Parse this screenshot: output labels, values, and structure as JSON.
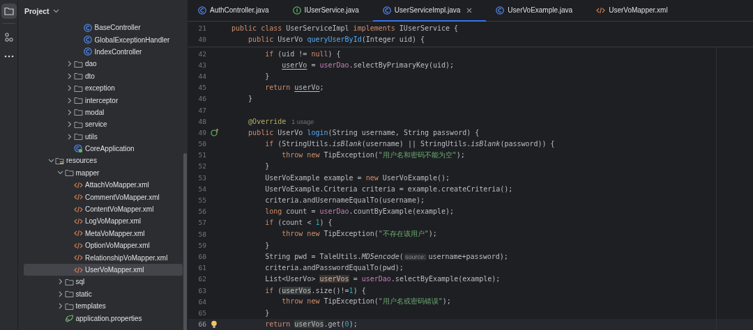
{
  "tool_strip": [
    {
      "kind": "project",
      "selected": true
    },
    {
      "kind": "structure",
      "selected": false
    },
    {
      "kind": "more",
      "selected": false
    }
  ],
  "project_panel": {
    "title": "Project",
    "tree": [
      {
        "children": [
          {
            "children": [
              {
                "children": [
                  {
                    "label": "BaseController",
                    "kind": "class",
                    "selected": false
                  },
                  {
                    "label": "GlobalExceptionHandler",
                    "kind": "class",
                    "selected": false
                  },
                  {
                    "label": "IndexController",
                    "kind": "class",
                    "selected": false
                  }
                ]
              },
              {
                "label": "dao",
                "kind": "folder",
                "expanded": false,
                "selected": false
              },
              {
                "label": "dto",
                "kind": "folder",
                "expanded": false,
                "selected": false
              },
              {
                "label": "exception",
                "kind": "folder",
                "expanded": false,
                "selected": false
              },
              {
                "label": "interceptor",
                "kind": "folder",
                "expanded": false,
                "selected": false
              },
              {
                "label": "modal",
                "kind": "folder",
                "expanded": false,
                "selected": false
              },
              {
                "label": "service",
                "kind": "folder",
                "expanded": false,
                "selected": false
              },
              {
                "label": "utils",
                "kind": "folder",
                "expanded": false,
                "selected": false
              },
              {
                "label": "CoreApplication",
                "kind": "app",
                "selected": false
              }
            ]
          }
        ]
      },
      {
        "label": "resources",
        "kind": "resources",
        "expanded": true,
        "selected": false,
        "children": [
          {
            "label": "mapper",
            "kind": "folder",
            "expanded": true,
            "selected": false,
            "children": [
              {
                "label": "AttachVoMapper.xml",
                "kind": "xml",
                "selected": false
              },
              {
                "label": "CommentVoMapper.xml",
                "kind": "xml",
                "selected": false
              },
              {
                "label": "ContentVoMapper.xml",
                "kind": "xml",
                "selected": false
              },
              {
                "label": "LogVoMapper.xml",
                "kind": "xml",
                "selected": false
              },
              {
                "label": "MetaVoMapper.xml",
                "kind": "xml",
                "selected": false
              },
              {
                "label": "OptionVoMapper.xml",
                "kind": "xml",
                "selected": false
              },
              {
                "label": "RelationshipVoMapper.xml",
                "kind": "xml",
                "selected": false
              },
              {
                "label": "UserVoMapper.xml",
                "kind": "xml",
                "selected": true
              }
            ]
          },
          {
            "label": "sql",
            "kind": "folder",
            "expanded": false,
            "selected": false
          },
          {
            "label": "static",
            "kind": "folder",
            "expanded": false,
            "selected": false
          },
          {
            "label": "templates",
            "kind": "folder",
            "expanded": false,
            "selected": false
          },
          {
            "label": "application.properties",
            "kind": "properties",
            "selected": false
          }
        ]
      }
    ]
  },
  "tabs": [
    {
      "label": "AuthController.java",
      "kind": "class",
      "selected": false
    },
    {
      "label": "IUserService.java",
      "kind": "interface",
      "selected": false
    },
    {
      "label": "UserServiceImpl.java",
      "kind": "class",
      "selected": true
    },
    {
      "label": "UserVoExample.java",
      "kind": "class",
      "selected": false
    },
    {
      "label": "UserVoMapper.xml",
      "kind": "xml",
      "selected": false
    }
  ],
  "sticky_lines": [
    {
      "number": "21",
      "tokens": [
        {
          "kind": "keyword",
          "text": "public class "
        },
        {
          "kind": "plain",
          "text": "UserServiceImpl "
        },
        {
          "kind": "keyword",
          "text": "implements "
        },
        {
          "kind": "plain",
          "text": "IUserService {"
        }
      ]
    },
    {
      "number": "40",
      "tokens": [
        {
          "kind": "keyword",
          "text": "    public "
        },
        {
          "kind": "plain",
          "text": "UserVo "
        },
        {
          "kind": "method",
          "text": "queryUserById"
        },
        {
          "kind": "plain",
          "text": "(Integer uid) {"
        }
      ]
    }
  ],
  "lines": [
    {
      "number": "42",
      "current": false,
      "tokens": [
        {
          "kind": "keyword",
          "text": "        if "
        },
        {
          "kind": "plain",
          "text": "(uid != "
        },
        {
          "kind": "keyword",
          "text": "null"
        },
        {
          "kind": "plain",
          "text": ") {"
        }
      ]
    },
    {
      "number": "43",
      "current": false,
      "tokens": [
        {
          "kind": "local",
          "text": "            userVo"
        },
        {
          "kind": "plain",
          "text": " = "
        },
        {
          "kind": "field",
          "text": "userDao"
        },
        {
          "kind": "plain",
          "text": ".selectByPrimaryKey(uid);"
        }
      ]
    },
    {
      "number": "44",
      "current": false,
      "tokens": [
        {
          "kind": "plain",
          "text": "        }"
        }
      ]
    },
    {
      "number": "45",
      "current": false,
      "tokens": [
        {
          "kind": "keyword",
          "text": "        return "
        },
        {
          "kind": "local",
          "text": "userVo"
        },
        {
          "kind": "plain",
          "text": ";"
        }
      ]
    },
    {
      "number": "46",
      "current": false,
      "tokens": [
        {
          "kind": "plain",
          "text": "    }"
        }
      ]
    },
    {
      "number": "47",
      "current": false
    },
    {
      "number": "48",
      "current": false,
      "tokens": [
        {
          "kind": "annotation",
          "text": "    @Override"
        },
        {
          "kind": "usages",
          "text": "1 usage"
        }
      ]
    },
    {
      "number": "49",
      "current": false,
      "gutter": {
        "kind": "override"
      },
      "tokens": [
        {
          "kind": "keyword",
          "text": "    public "
        },
        {
          "kind": "plain",
          "text": "UserVo "
        },
        {
          "kind": "method",
          "text": "login"
        },
        {
          "kind": "plain",
          "text": "(String username, String password) {"
        }
      ]
    },
    {
      "number": "50",
      "current": false,
      "tokens": [
        {
          "kind": "keyword",
          "text": "        if "
        },
        {
          "kind": "plain",
          "text": "(StringUtils."
        },
        {
          "kind": "static",
          "text": "isBlank"
        },
        {
          "kind": "plain",
          "text": "(username) || StringUtils."
        },
        {
          "kind": "static",
          "text": "isBlank"
        },
        {
          "kind": "plain",
          "text": "(password)) {"
        }
      ]
    },
    {
      "number": "51",
      "current": false,
      "tokens": [
        {
          "kind": "keyword",
          "text": "            throw new "
        },
        {
          "kind": "plain",
          "text": "TipException("
        },
        {
          "kind": "string",
          "text": "\"用户名和密码不能为空\""
        },
        {
          "kind": "plain",
          "text": ");"
        }
      ]
    },
    {
      "number": "52",
      "current": false,
      "tokens": [
        {
          "kind": "plain",
          "text": "        }"
        }
      ]
    },
    {
      "number": "53",
      "current": false,
      "tokens": [
        {
          "kind": "plain",
          "text": "        UserVoExample example = "
        },
        {
          "kind": "keyword",
          "text": "new "
        },
        {
          "kind": "plain",
          "text": "UserVoExample();"
        }
      ]
    },
    {
      "number": "54",
      "current": false,
      "tokens": [
        {
          "kind": "plain",
          "text": "        UserVoExample.Criteria criteria = example.createCriteria();"
        }
      ]
    },
    {
      "number": "55",
      "current": false,
      "tokens": [
        {
          "kind": "plain",
          "text": "        criteria.andUsernameEqualTo(username);"
        }
      ]
    },
    {
      "number": "56",
      "current": false,
      "tokens": [
        {
          "kind": "keyword",
          "text": "        long "
        },
        {
          "kind": "plain",
          "text": "count = "
        },
        {
          "kind": "field",
          "text": "userDao"
        },
        {
          "kind": "plain",
          "text": ".countByExample(example);"
        }
      ]
    },
    {
      "number": "57",
      "current": false,
      "tokens": [
        {
          "kind": "keyword",
          "text": "        if "
        },
        {
          "kind": "plain",
          "text": "(count < "
        },
        {
          "kind": "number",
          "text": "1"
        },
        {
          "kind": "plain",
          "text": ") {"
        }
      ]
    },
    {
      "number": "58",
      "current": false,
      "tokens": [
        {
          "kind": "keyword",
          "text": "            throw new "
        },
        {
          "kind": "plain",
          "text": "TipException("
        },
        {
          "kind": "string",
          "text": "\"不存在该用户\""
        },
        {
          "kind": "plain",
          "text": ");"
        }
      ]
    },
    {
      "number": "59",
      "current": false,
      "tokens": [
        {
          "kind": "plain",
          "text": "        }"
        }
      ]
    },
    {
      "number": "60",
      "current": false,
      "tokens": [
        {
          "kind": "plain",
          "text": "        String pwd = TaleUtils."
        },
        {
          "kind": "static",
          "text": "MD5encode"
        },
        {
          "kind": "plain",
          "text": "("
        },
        {
          "kind": "hint",
          "text": "source:"
        },
        {
          "kind": "plain",
          "text": "username+password);"
        }
      ]
    },
    {
      "number": "61",
      "current": false,
      "tokens": [
        {
          "kind": "plain",
          "text": "        criteria.andPasswordEqualTo(pwd);"
        }
      ]
    },
    {
      "number": "62",
      "current": false,
      "tokens": [
        {
          "kind": "plain",
          "text": "        List<UserVo> "
        },
        {
          "kind": "local_write",
          "text": "userVos"
        },
        {
          "kind": "plain",
          "text": " = "
        },
        {
          "kind": "field",
          "text": "userDao"
        },
        {
          "kind": "plain",
          "text": ".selectByExample(example);"
        }
      ]
    },
    {
      "number": "63",
      "current": false,
      "tokens": [
        {
          "kind": "keyword",
          "text": "        if "
        },
        {
          "kind": "plain",
          "text": "("
        },
        {
          "kind": "local_read",
          "text": "userVos"
        },
        {
          "kind": "plain",
          "text": ".size()!="
        },
        {
          "kind": "number",
          "text": "1"
        },
        {
          "kind": "plain",
          "text": ") {"
        }
      ]
    },
    {
      "number": "64",
      "current": false,
      "tokens": [
        {
          "kind": "keyword",
          "text": "            throw new "
        },
        {
          "kind": "plain",
          "text": "TipException("
        },
        {
          "kind": "string",
          "text": "\"用户名或密码错误\""
        },
        {
          "kind": "plain",
          "text": ");"
        }
      ]
    },
    {
      "number": "65",
      "current": false,
      "tokens": [
        {
          "kind": "plain",
          "text": "        }"
        }
      ]
    },
    {
      "number": "66",
      "current": true,
      "gutter": {
        "kind": "bulb"
      },
      "tokens": [
        {
          "kind": "keyword",
          "text": "        return "
        },
        {
          "kind": "local_read",
          "text": "userVos"
        },
        {
          "kind": "plain",
          "text": ".get("
        },
        {
          "kind": "number",
          "text": "0"
        },
        {
          "kind": "plain",
          "text": ");"
        }
      ]
    }
  ]
}
